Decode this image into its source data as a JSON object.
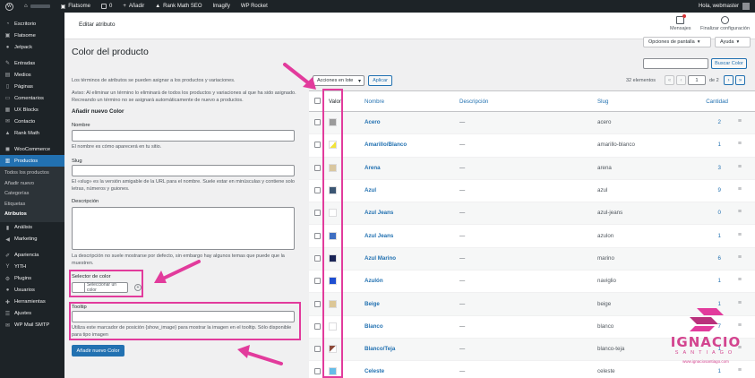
{
  "adminbar": {
    "site_name": "Flatsome",
    "comments_count": "0",
    "add_new": "Añadir",
    "rank_math": "Rank Math SEO",
    "imagify": "Imagify",
    "wp_rocket": "WP Rocket",
    "greeting": "Hola, webmaster"
  },
  "sidebar": {
    "items": [
      {
        "label": "Escritorio",
        "icon": "dashboard-icon"
      },
      {
        "label": "Flatsome",
        "icon": "flatsome-icon"
      },
      {
        "label": "Jetpack",
        "icon": "jetpack-icon"
      },
      {
        "label": "Entradas",
        "icon": "pin-icon"
      },
      {
        "label": "Medios",
        "icon": "media-icon"
      },
      {
        "label": "Páginas",
        "icon": "pages-icon"
      },
      {
        "label": "Comentarios",
        "icon": "comment-icon"
      },
      {
        "label": "UX Blocks",
        "icon": "blocks-icon"
      },
      {
        "label": "Contacto",
        "icon": "mail-icon"
      },
      {
        "label": "Rank Math",
        "icon": "chart-icon"
      },
      {
        "label": "WooCommerce",
        "icon": "woo-icon"
      },
      {
        "label": "Productos",
        "icon": "archive-icon"
      }
    ],
    "submenu": [
      "Todos los productos",
      "Añadir nuevo",
      "Categorías",
      "Etiquetas",
      "Atributos"
    ],
    "items_after": [
      {
        "label": "Análisis",
        "icon": "analytics-icon"
      },
      {
        "label": "Marketing",
        "icon": "megaphone-icon"
      },
      {
        "label": "Apariencia",
        "icon": "brush-icon"
      },
      {
        "label": "YITH",
        "icon": "yith-icon"
      },
      {
        "label": "Plugins",
        "icon": "plugin-icon"
      },
      {
        "label": "Usuarios",
        "icon": "user-icon"
      },
      {
        "label": "Herramientas",
        "icon": "wrench-icon"
      },
      {
        "label": "Ajustes",
        "icon": "settings-icon"
      },
      {
        "label": "WP Mail SMTP",
        "icon": "mail-smtp-icon"
      }
    ]
  },
  "header": {
    "title": "Editar atributo",
    "messages": "Mensajes",
    "finish_setup": "Finalizar configuración",
    "screen_options": "Opciones de pantalla",
    "help": "Ayuda"
  },
  "page": {
    "title": "Color del producto",
    "intro": "Los términos de atributos se pueden asignar a los productos y variaciones.",
    "warning": "Aviso: Al eliminar un término lo eliminará de todos los productos y variaciones al que ha sido asignado. Recreando un término no se asignará automáticamente de nuevo a productos.",
    "form_title": "Añadir nuevo Color",
    "name_label": "Nombre",
    "name_help": "El nombre es cómo aparecerá en tu sitio.",
    "slug_label": "Slug",
    "slug_help": "El «slug» es la versión amigable de la URL para el nombre. Suele estar en minúsculas y contiene solo letras, números y guiones.",
    "desc_label": "Descripción",
    "desc_help": "La descripción no suele mostrarse por defecto, sin embargo hay algunos temas que puede que la muestren.",
    "color_label": "Selector de color",
    "color_button": "Seleccionar un color",
    "tooltip_label": "Tooltip",
    "tooltip_help": "Utiliza este marcador de posición {show_image} para mostrar la imagen en el tooltip. Sólo disponible para tipo imagen",
    "submit": "Añadir nuevo Color"
  },
  "table_controls": {
    "bulk_select": "Acciones en lote",
    "apply": "Aplicar",
    "search_button": "Buscar Color",
    "items_count": "32 elementos",
    "page_current": "1",
    "page_of": "de 2"
  },
  "table": {
    "headers": {
      "value": "Valor",
      "name": "Nombre",
      "description": "Descripción",
      "slug": "Slug",
      "count": "Cantidad"
    },
    "rows": [
      {
        "name": "Acero",
        "desc": "—",
        "slug": "acero",
        "count": "2",
        "color": "#9b9b9b"
      },
      {
        "name": "Amarillo/Blanco",
        "desc": "—",
        "slug": "amarillo-blanco",
        "count": "1",
        "color": "#f2e33a",
        "color2": "#ffffff"
      },
      {
        "name": "Arena",
        "desc": "—",
        "slug": "arena",
        "count": "3",
        "color": "#d9c7a0"
      },
      {
        "name": "Azul",
        "desc": "—",
        "slug": "azul",
        "count": "9",
        "color": "#3b5673"
      },
      {
        "name": "Azul Jeans",
        "desc": "—",
        "slug": "azul-jeans",
        "count": "0",
        "color": "#ffffff"
      },
      {
        "name": "Azul Jeans",
        "desc": "—",
        "slug": "azulon",
        "count": "1",
        "color": "#3f6fc2"
      },
      {
        "name": "Azul Marino",
        "desc": "—",
        "slug": "marino",
        "count": "6",
        "color": "#1a2456"
      },
      {
        "name": "Azulón",
        "desc": "—",
        "slug": "naviglio",
        "count": "1",
        "color": "#1f4fd1"
      },
      {
        "name": "Beige",
        "desc": "—",
        "slug": "beige",
        "count": "1",
        "color": "#dcc797"
      },
      {
        "name": "Blanco",
        "desc": "—",
        "slug": "blanco",
        "count": "7",
        "color": "#ffffff"
      },
      {
        "name": "Blanco/Teja",
        "desc": "—",
        "slug": "blanco-teja",
        "count": "1",
        "color": "#ffffff",
        "color2": "#8c4a3a"
      },
      {
        "name": "Celeste",
        "desc": "—",
        "slug": "celeste",
        "count": "1",
        "color": "#66bde8"
      }
    ]
  },
  "watermark": {
    "brand": "IGNACIO",
    "sub": "SANTIAGO",
    "url": "www.ignaciosantiago.com"
  },
  "colors": {
    "accent": "#2271b1",
    "annotation": "#e23b9c",
    "admin_dark": "#1d2327"
  }
}
